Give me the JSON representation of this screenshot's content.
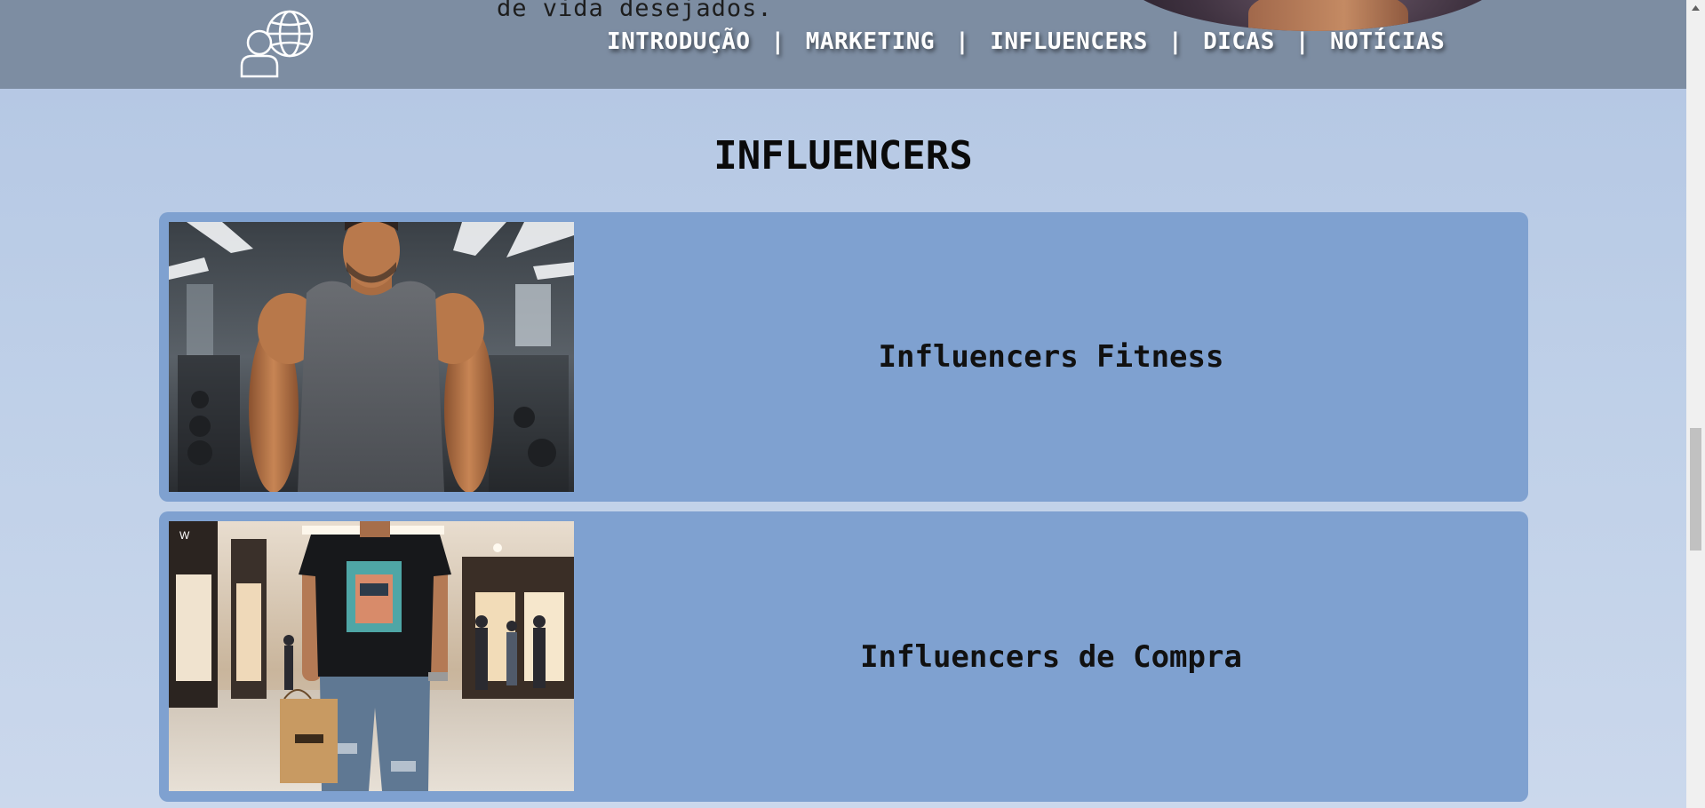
{
  "header": {
    "intro_text_fragment": "de vida desejados.",
    "logo_icon": "user-globe-icon",
    "nav": [
      {
        "label": "INTRODUÇÃO"
      },
      {
        "label": "MARKETING"
      },
      {
        "label": "INFLUENCERS"
      },
      {
        "label": "DICAS"
      },
      {
        "label": "NOTÍCIAS"
      }
    ],
    "separator": "|"
  },
  "section": {
    "title": "INFLUENCERS",
    "cards": [
      {
        "title": "Influencers Fitness",
        "image": "man in gray tank top at gym"
      },
      {
        "title": "Influencers de Compra",
        "image": "man in black t-shirt with shopping bag in mall"
      }
    ]
  },
  "colors": {
    "header_bg": "#7d8da2",
    "page_bg": "#b3c6e3",
    "card_bg": "#7fa1d0",
    "nav_text": "#ffffff"
  }
}
